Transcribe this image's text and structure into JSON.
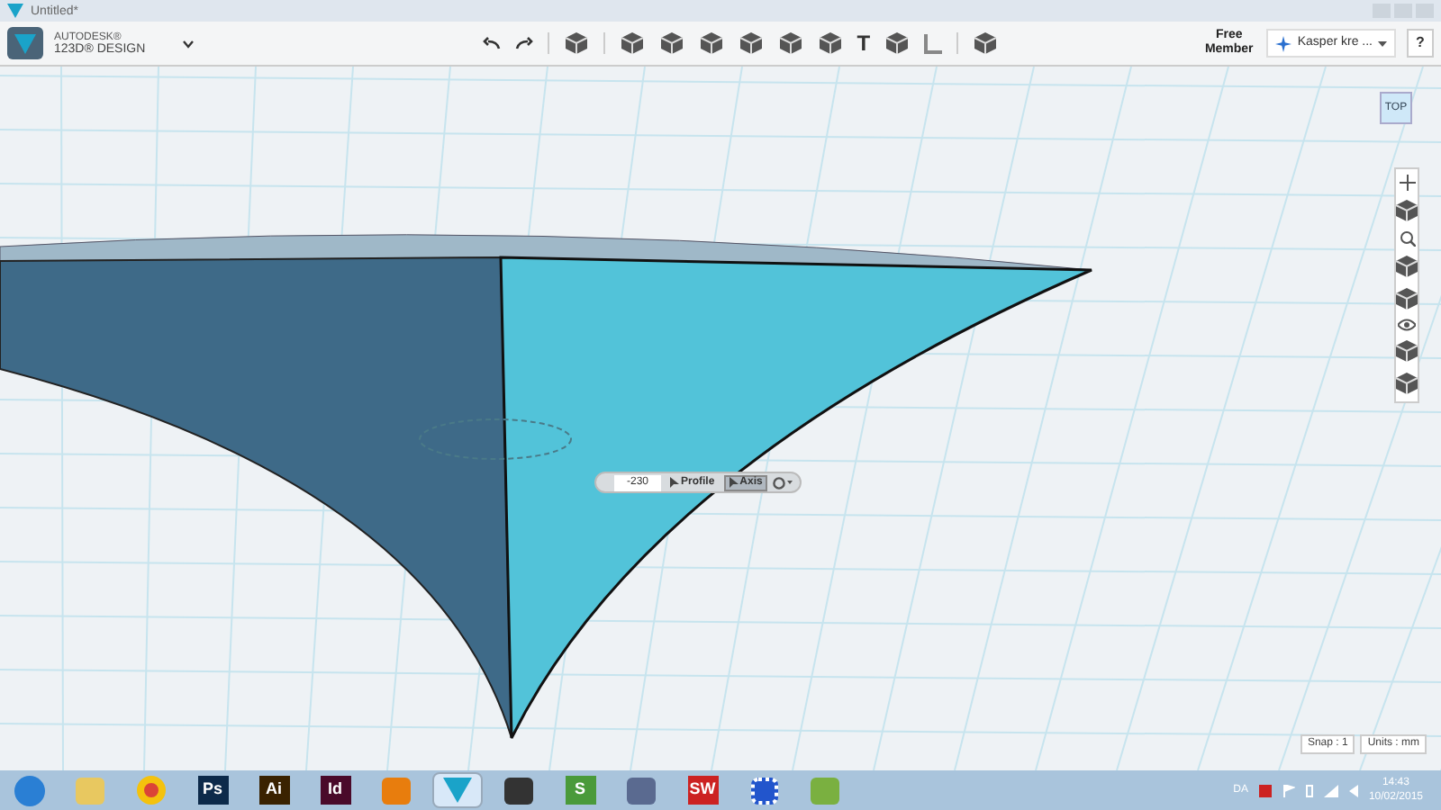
{
  "window": {
    "title": "Untitled*"
  },
  "brand": {
    "line1": "AUTODESK®",
    "line2": "123D® DESIGN"
  },
  "tools": {
    "text_tool": "T"
  },
  "account": {
    "membership": "Free Member",
    "user": "Kasper kre ...",
    "help": "?"
  },
  "view_cube": {
    "label": "TOP"
  },
  "input_bar": {
    "value": "-230",
    "buttons": [
      {
        "label": "Profile",
        "selected": false
      },
      {
        "label": "Axis",
        "selected": true
      }
    ]
  },
  "status": {
    "snap": "Snap : 1",
    "units": "Units : mm"
  },
  "taskbar": {
    "apps": [
      {
        "kind": "start",
        "color": "#2a7fd4"
      },
      {
        "kind": "folder",
        "color": "#e8c860"
      },
      {
        "kind": "browser",
        "color": "#db4437"
      },
      {
        "kind": "lettered",
        "label": "Ps",
        "color": "#0d2a4a"
      },
      {
        "kind": "lettered",
        "label": "Ai",
        "color": "#3a2200"
      },
      {
        "kind": "lettered",
        "label": "Id",
        "color": "#4a0a2a"
      },
      {
        "kind": "blender",
        "color": "#e87d0d"
      },
      {
        "kind": "design",
        "color": "#1aa3c9",
        "selected": true
      },
      {
        "kind": "inkscape",
        "color": "#333333"
      },
      {
        "kind": "lettered",
        "label": "S",
        "color": "#4a9a3a"
      },
      {
        "kind": "box",
        "color": "#5a6a90"
      },
      {
        "kind": "lettered",
        "label": "SW",
        "color": "#cc2222"
      },
      {
        "kind": "gear",
        "color": "#2255cc"
      },
      {
        "kind": "folder",
        "color": "#7ab040"
      }
    ],
    "tray": {
      "language": "DA",
      "time": "14:43",
      "date": "10/02/2015"
    }
  }
}
